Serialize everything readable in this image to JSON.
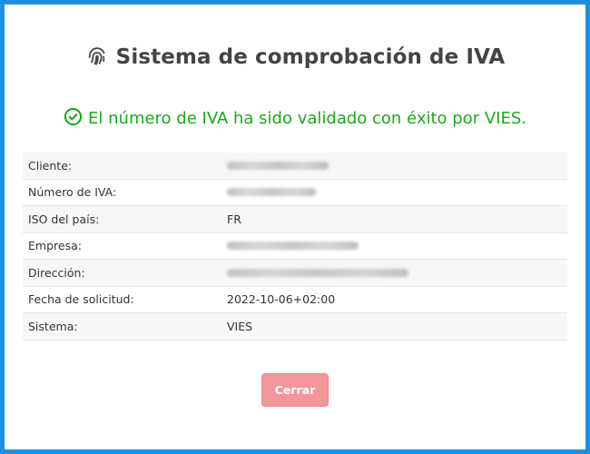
{
  "dialog": {
    "title": "Sistema de comprobación de IVA",
    "title_icon": "fingerprint-icon",
    "success_icon": "check-circle-icon",
    "success_message": "El número de IVA ha sido validado con éxito por VIES.",
    "close_label": "Cerrar"
  },
  "colors": {
    "frame_border": "#1e8fe0",
    "success": "#1aaa1a",
    "title": "#444444",
    "close_button": "#f2969a"
  },
  "details": [
    {
      "label": "Cliente:",
      "value": "",
      "redacted": true
    },
    {
      "label": "Número de IVA:",
      "value": "",
      "redacted": true
    },
    {
      "label": "ISO del país:",
      "value": "FR",
      "redacted": false
    },
    {
      "label": "Empresa:",
      "value": "",
      "redacted": true
    },
    {
      "label": "Dirección:",
      "value": "",
      "redacted": true
    },
    {
      "label": "Fecha de solicitud:",
      "value": "2022-10-06+02:00",
      "redacted": false
    },
    {
      "label": "Sistema:",
      "value": "VIES",
      "redacted": false
    }
  ]
}
